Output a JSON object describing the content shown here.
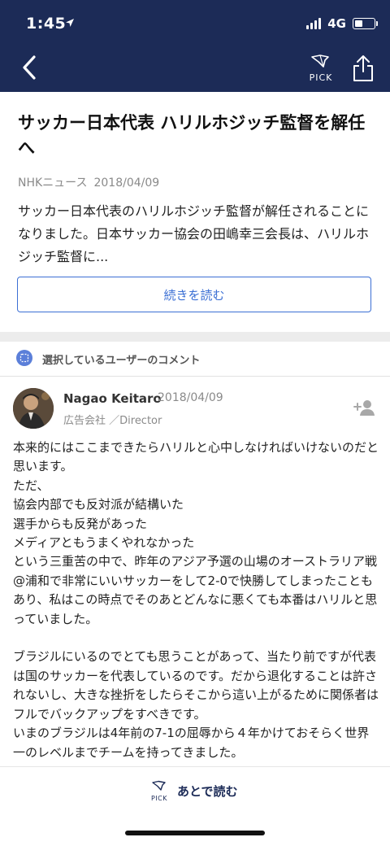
{
  "status": {
    "time": "1:45",
    "network": "4G",
    "battery_level": 0.45
  },
  "header": {
    "pick_label": "PICK"
  },
  "article": {
    "title": "サッカー日本代表 ハリルホジッチ監督を解任へ",
    "source": "NHKニュース",
    "date": "2018/04/09",
    "summary": "サッカー日本代表のハリルホジッチ監督が解任されることになりました。日本サッカー協会の田嶋幸三会長は、ハリルホジッチ監督に...",
    "readmore_label": "続きを読む"
  },
  "comments_section": {
    "title": "選択しているユーザーのコメント"
  },
  "comment": {
    "user_name": "Nagao Keitaro",
    "date": "2018/04/09",
    "role": "広告会社 ／Director",
    "body": "本来的にはここまできたらハリルと心中しなければいけないのだと思います。\nただ、\n協会内部でも反対派が結構いた\n選手からも反発があった\nメディアともうまくやれなかった\nという三重苦の中で、昨年のアジア予選の山場のオーストラリア戦@浦和で非常にいいサッカーをして2-0で快勝してしまったこともあり、私はこの時点でそのあとどんなに悪くても本番はハリルと思っていました。\n\nブラジルにいるのでとても思うことがあって、当たり前ですが代表は国のサッカーを代表しているのです。だから退化することは許されないし、大きな挫折をしたらそこから這い上がるために関係者はフルでバックアップをすべきです。\nいまのブラジルは4年前の7-1の屈辱から４年かけておそらく世界一のレベルまでチームを持ってきました。"
  },
  "bottom_bar": {
    "pick_label": "PICK",
    "later_label": "あとで読む"
  },
  "colors": {
    "header_bg": "#1c2b57",
    "accent": "#3b6fd4"
  },
  "icons": [
    "location-arrow-icon",
    "signal-icon",
    "battery-icon",
    "back-chevron-icon",
    "pick-icon",
    "share-icon",
    "user-group-icon",
    "follow-user-icon"
  ]
}
